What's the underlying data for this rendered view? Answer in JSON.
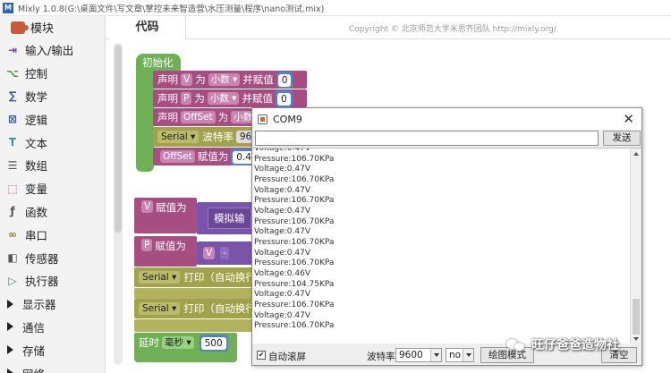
{
  "window": {
    "title": "Mixly 1.0.8(G:\\桌面文件\\写文章\\掌控未来智造营\\水压测量\\程序\\nano测试.mix)"
  },
  "sidebar": {
    "header": "模块",
    "items": [
      {
        "label": "输入/输出",
        "icon": "io-icon",
        "color": "#7a3bb5"
      },
      {
        "label": "控制",
        "icon": "control-icon",
        "color": "#4a8a3a"
      },
      {
        "label": "数学",
        "icon": "math-icon",
        "color": "#3a5aa8"
      },
      {
        "label": "逻辑",
        "icon": "logic-icon",
        "color": "#3a5aa8"
      },
      {
        "label": "文本",
        "icon": "text-icon",
        "color": "#3a8aa8"
      },
      {
        "label": "数组",
        "icon": "array-icon",
        "color": "#555"
      },
      {
        "label": "变量",
        "icon": "variable-icon",
        "color": "#b04a8a"
      },
      {
        "label": "函数",
        "icon": "function-icon",
        "color": "#555"
      },
      {
        "label": "串口",
        "icon": "serial-icon",
        "color": "#8a7a2a"
      },
      {
        "label": "传感器",
        "icon": "sensor-icon",
        "color": "#555"
      },
      {
        "label": "执行器",
        "icon": "actuator-icon",
        "color": "#3a8a6a"
      },
      {
        "label": "显示器",
        "icon": "arrow"
      },
      {
        "label": "通信",
        "icon": "arrow"
      },
      {
        "label": "存储",
        "icon": "arrow"
      },
      {
        "label": "网络",
        "icon": "arrow"
      }
    ]
  },
  "tabs": {
    "code": "代码",
    "copyright": "Copyright © 北京师范大学米思齐团队 http://mixly.org/"
  },
  "blocks": {
    "init": "初始化",
    "declare_v": [
      "声明",
      "V",
      "为",
      "小数",
      "并赋值",
      "0"
    ],
    "declare_p": [
      "声明",
      "P",
      "为",
      "小数",
      "并赋值",
      "0"
    ],
    "declare_offset": [
      "声明",
      "OffSet",
      "为",
      "小数"
    ],
    "serial_baud": [
      "Serial",
      "波特率",
      "96"
    ],
    "offset_assign": [
      "OffSet",
      "赋值为",
      "0.4"
    ],
    "v_assign": [
      "V",
      "赋值为",
      "模拟输"
    ],
    "p_assign": [
      "P",
      "赋值为",
      "V",
      "-"
    ],
    "print1": [
      "Serial",
      "打印（自动换行"
    ],
    "print2": [
      "Serial",
      "打印（自动换行"
    ],
    "delay": [
      "延时",
      "毫秒",
      "500"
    ]
  },
  "monitor": {
    "title": "COM9",
    "send_label": "发送",
    "input_value": "",
    "lines": [
      "Voltage:0.47V",
      "Pressure:106.70KPa",
      "Voltage:0.47V",
      "Pressure:106.70KPa",
      "Voltage:0.47V",
      "Pressure:106.70KPa",
      "Voltage:0.47V",
      "Pressure:106.70KPa",
      "Voltage:0.47V",
      "Pressure:106.70KPa",
      "Voltage:0.47V",
      "Pressure:106.70KPa",
      "Voltage:0.46V",
      "Pressure:104.75KPa",
      "Voltage:0.47V",
      "Pressure:106.70KPa",
      "Voltage:0.47V",
      "Pressure:106.70KPa"
    ],
    "autoscroll_label": "自动滚屏",
    "autoscroll_checked": true,
    "baud_label": "波特率",
    "baud_value": "9600",
    "line_ending_value": "no",
    "plot_label": "绘图模式",
    "clear_label": "清空"
  },
  "watermark": "旺仔爸爸造物社"
}
